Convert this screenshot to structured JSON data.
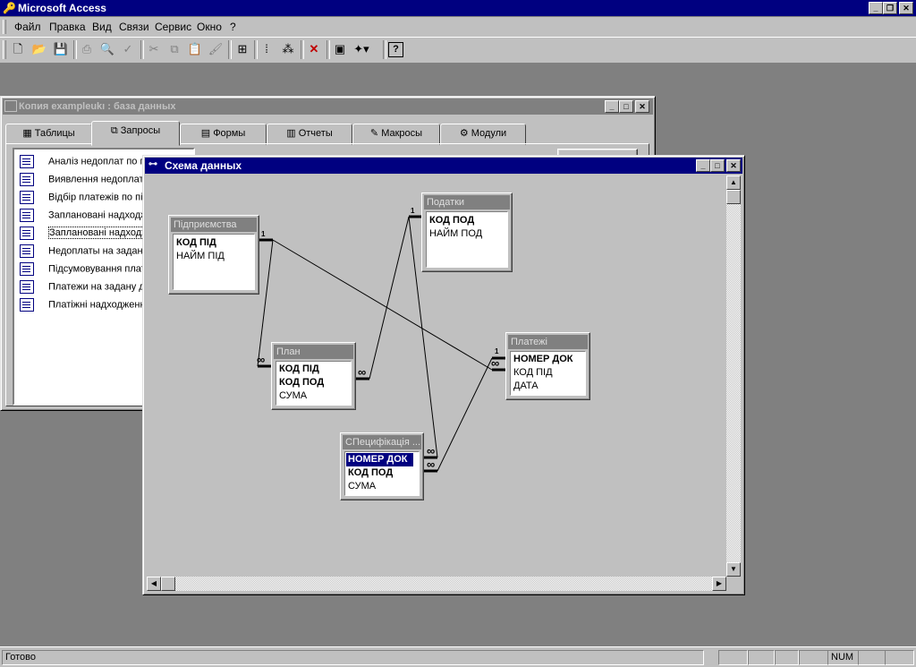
{
  "app": {
    "title": "Microsoft Access"
  },
  "menu": [
    "Файл",
    "Правка",
    "Вид",
    "Связи",
    "Сервис",
    "Окно",
    "?"
  ],
  "db_window": {
    "title": "Копия exampleukı : база данных",
    "tabs": [
      "Таблицы",
      "Запросы",
      "Формы",
      "Отчеты",
      "Макросы",
      "Модули"
    ],
    "active_tab": "Запросы",
    "queries": [
      "Аналіз недоплат по пі...",
      "Виявлення недоплат",
      "Відбір платежів по під",
      "Заплановані надходж",
      "Заплановані надходж",
      "Недоплаты на заданн",
      "Підсумовування плате",
      "Платежи на задану да",
      "Платіжні надходженн"
    ]
  },
  "rel_window": {
    "title": "Схема данных",
    "tables": {
      "pidpr": {
        "title": "Підприємства",
        "fields": [
          "КОД ПІД",
          "НАЙМ ПІД"
        ]
      },
      "podatki": {
        "title": "Податки",
        "fields": [
          "КОД ПОД",
          "НАЙМ ПОД"
        ]
      },
      "plan": {
        "title": "План",
        "fields": [
          "КОД ПІД",
          "КОД ПОД",
          "СУМА"
        ]
      },
      "platezhi": {
        "title": "Платежі",
        "fields": [
          "НОМЕР ДОК",
          "КОД ПІД",
          "ДАТА"
        ]
      },
      "spec": {
        "title": "СПецифікація ...",
        "fields": [
          "НОМЕР ДОК",
          "КОД ПОД",
          "СУМА"
        ]
      }
    },
    "cardinality": {
      "one": "1",
      "many": "∞"
    }
  },
  "status": {
    "text": "Готово",
    "num": "NUM"
  },
  "colors": {
    "titlebar_active": "#000080",
    "titlebar_inactive": "#808080",
    "face": "#c0c0c0"
  }
}
